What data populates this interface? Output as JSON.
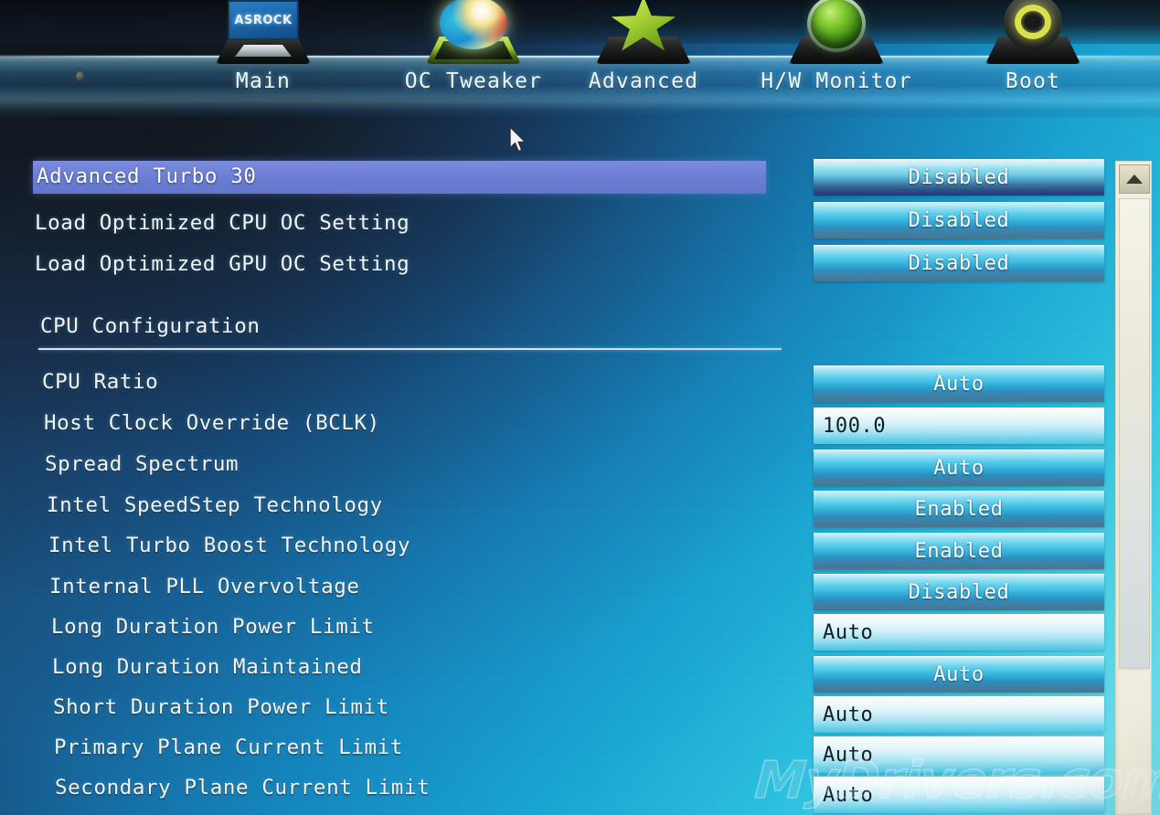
{
  "nav": {
    "tabs": [
      {
        "label": "Main",
        "icon": "monitor-icon",
        "active": false
      },
      {
        "label": "OC Tweaker",
        "icon": "orb-icon",
        "active": true
      },
      {
        "label": "Advanced",
        "icon": "star-icon",
        "active": false
      },
      {
        "label": "H/W Monitor",
        "icon": "sphere-icon",
        "active": false
      },
      {
        "label": "Boot",
        "icon": "ring-icon",
        "active": false
      }
    ],
    "brand": "ASROCK"
  },
  "settings": {
    "items": [
      {
        "label": "Advanced Turbo 30",
        "value": "Disabled",
        "control": "dropdown",
        "selected": true
      },
      {
        "label": "Load Optimized CPU OC Setting",
        "value": "Disabled",
        "control": "dropdown",
        "selected": false
      },
      {
        "label": "Load Optimized GPU OC Setting",
        "value": "Disabled",
        "control": "dropdown",
        "selected": false
      }
    ],
    "section_heading": "CPU Configuration",
    "cpu_items": [
      {
        "label": "CPU Ratio",
        "value": "Auto",
        "control": "dropdown"
      },
      {
        "label": "Host Clock Override (BCLK)",
        "value": "100.0",
        "control": "textbox"
      },
      {
        "label": "Spread Spectrum",
        "value": "Auto",
        "control": "dropdown"
      },
      {
        "label": "Intel SpeedStep Technology",
        "value": "Enabled",
        "control": "dropdown"
      },
      {
        "label": "Intel Turbo Boost Technology",
        "value": "Enabled",
        "control": "dropdown"
      },
      {
        "label": "Internal PLL Overvoltage",
        "value": "Disabled",
        "control": "dropdown"
      },
      {
        "label": "Long Duration Power Limit",
        "value": "Auto",
        "control": "textbox"
      },
      {
        "label": "Long Duration Maintained",
        "value": "Auto",
        "control": "dropdown"
      },
      {
        "label": "Short Duration Power Limit",
        "value": "Auto",
        "control": "textbox"
      },
      {
        "label": "Primary Plane Current Limit",
        "value": "Auto",
        "control": "textbox"
      },
      {
        "label": "Secondary Plane Current Limit",
        "value": "Auto",
        "control": "textbox"
      }
    ]
  },
  "scrollbar": {
    "up_arrow": "scroll-up-arrow"
  },
  "watermark": {
    "text": "MyDrivers.com"
  },
  "colors": {
    "selection_blue": "#6c7fd6",
    "value_cyan": "#36b7df",
    "text_white": "#f2f8fb",
    "scrollbar_beige": "#eceadd",
    "accent_green": "#aed439"
  }
}
